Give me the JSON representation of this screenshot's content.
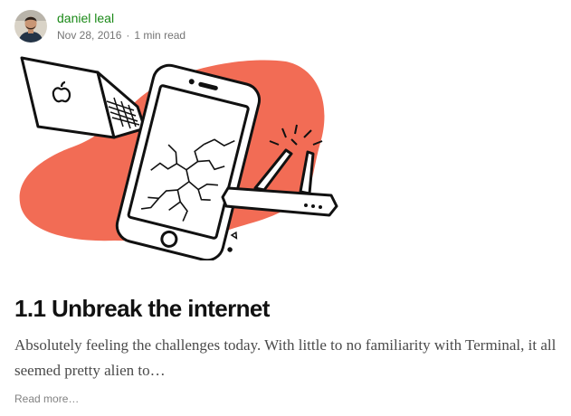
{
  "author": {
    "name": "daniel leal",
    "avatar_icon": "person-avatar"
  },
  "post": {
    "date": "Nov 28, 2016",
    "separator": "·",
    "read_time": "1 min read",
    "title": "1.1 Unbreak the internet",
    "excerpt": "Absolutely feeling the challenges today. With little to no familiarity with Terminal, it all seemed pretty alien to…",
    "read_more": "Read more…",
    "illustration": "laptop-cracked-phone-router-illustration"
  },
  "colors": {
    "author_link": "#1a8917",
    "blob": "#f26c55",
    "meta_text": "#757575"
  }
}
